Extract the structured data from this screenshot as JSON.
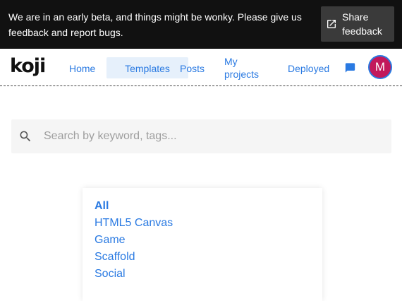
{
  "banner": {
    "message": "We are in an early beta, and things might be wonky. Please give us feedback and report bugs.",
    "share_label": "Share feedback",
    "share_icon": "external-link-icon"
  },
  "nav": {
    "logo": "koji",
    "items": [
      {
        "label": "Home"
      },
      {
        "label": "Templates",
        "active": true
      },
      {
        "label": "Posts"
      },
      {
        "label": "My projects"
      },
      {
        "label": "Deployed"
      }
    ],
    "chat_icon": "chat-bubble-icon",
    "avatar_letter": "M",
    "avatar_color": "#c2185b",
    "accent": "#2a7ae2"
  },
  "search": {
    "placeholder": "Search by keyword, tags...",
    "value": "",
    "icon": "search-icon"
  },
  "filters": {
    "items": [
      {
        "label": "All",
        "active": true
      },
      {
        "label": "HTML5 Canvas"
      },
      {
        "label": "Game"
      },
      {
        "label": "Scaffold"
      },
      {
        "label": "Social"
      }
    ]
  }
}
